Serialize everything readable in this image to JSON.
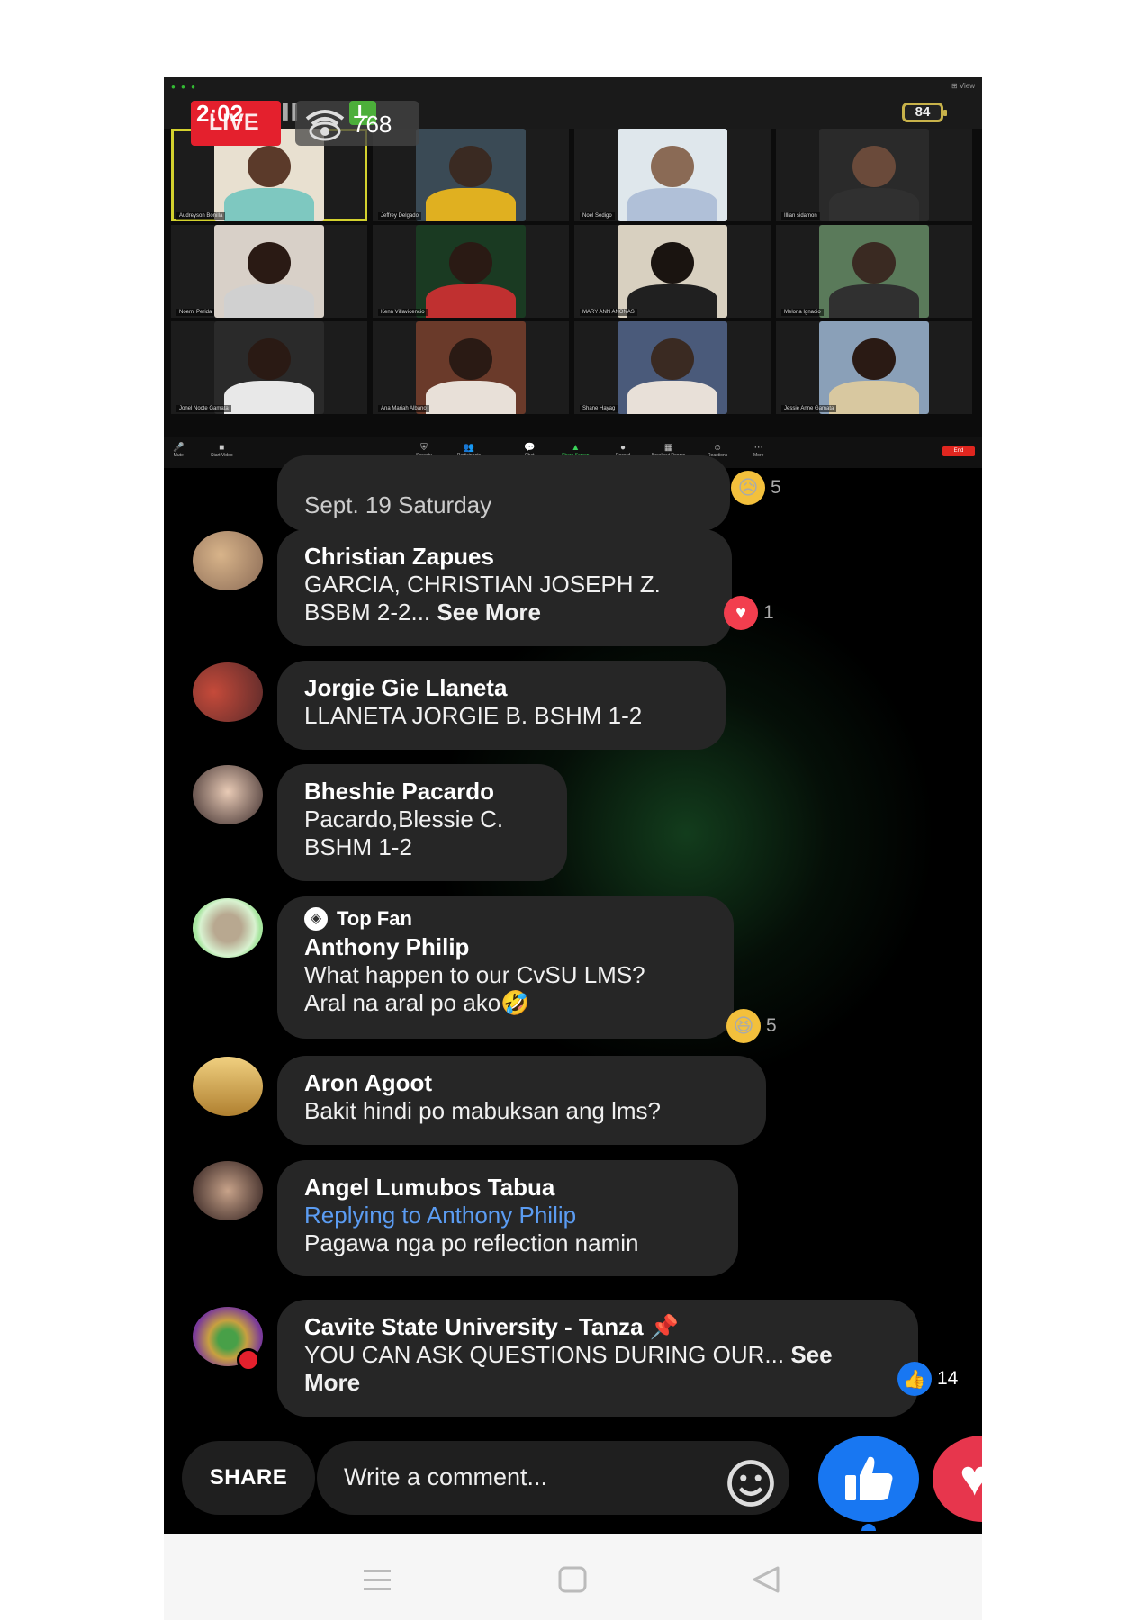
{
  "stream": {
    "time": "2:02",
    "live_label": "LIVE",
    "viewer_count": "768",
    "app_badge": "L",
    "battery": "84"
  },
  "participants": [
    {
      "name": "Audreyson Bonilla",
      "active": true
    },
    {
      "name": "Jeffrey Delgado"
    },
    {
      "name": "Noel Sedigo"
    },
    {
      "name": "Illian sidamon"
    },
    {
      "name": "Noemi Perida"
    },
    {
      "name": "Kenn Villavicencio"
    },
    {
      "name": "MARY ANN ANONAS"
    },
    {
      "name": "Melona Ignacio"
    },
    {
      "name": "Jonel Nocte Gamata"
    },
    {
      "name": "Ana Mariah Albano"
    },
    {
      "name": "Shane Hayag"
    },
    {
      "name": "Jessie Anne Gamata"
    }
  ],
  "zoom_toolbar": [
    "Mute",
    "Start Video",
    "Security",
    "Participants",
    "Chat",
    "Share Screen",
    "Record",
    "Breakout Rooms",
    "Reactions",
    "More"
  ],
  "zoom_end": "End",
  "comments": [
    {
      "text": "Sept. 19 Saturday",
      "reaction": "sad",
      "count": "5"
    },
    {
      "name": "Christian Zapues",
      "text": "GARCIA, CHRISTIAN JOSEPH Z.",
      "text2": "BSBM 2-2...",
      "see_more": "See More",
      "reaction": "love",
      "count": "1"
    },
    {
      "name": "Jorgie Gie Llaneta",
      "text": "LLANETA JORGIE B. BSHM 1-2"
    },
    {
      "name": "Bheshie Pacardo",
      "text": "Pacardo,Blessie C.",
      "text2": "BSHM 1-2"
    },
    {
      "badge": "Top Fan",
      "name": "Anthony Philip",
      "text": "What happen to our CvSU LMS?",
      "text2": "Aral na aral po ako🤣",
      "reaction": "haha",
      "count": "5"
    },
    {
      "name": "Aron Agoot",
      "text": "Bakit hindi po mabuksan ang lms?"
    },
    {
      "name": "Angel Lumubos Tabua",
      "reply_to": "Replying to Anthony Philip",
      "text": "Pagawa nga po reflection namin"
    },
    {
      "name": "Cavite State University - Tanza",
      "text": "YOU CAN ASK QUESTIONS DURING OUR...",
      "see_more": "See",
      "see_more2": "More",
      "reaction": "like",
      "count": "14"
    }
  ],
  "footer": {
    "share_label": "SHARE",
    "comment_placeholder": "Write a comment..."
  },
  "colors": {
    "live": "#e4202d",
    "link": "#5b9cf2",
    "like": "#1877f2",
    "love": "#e7364d"
  }
}
